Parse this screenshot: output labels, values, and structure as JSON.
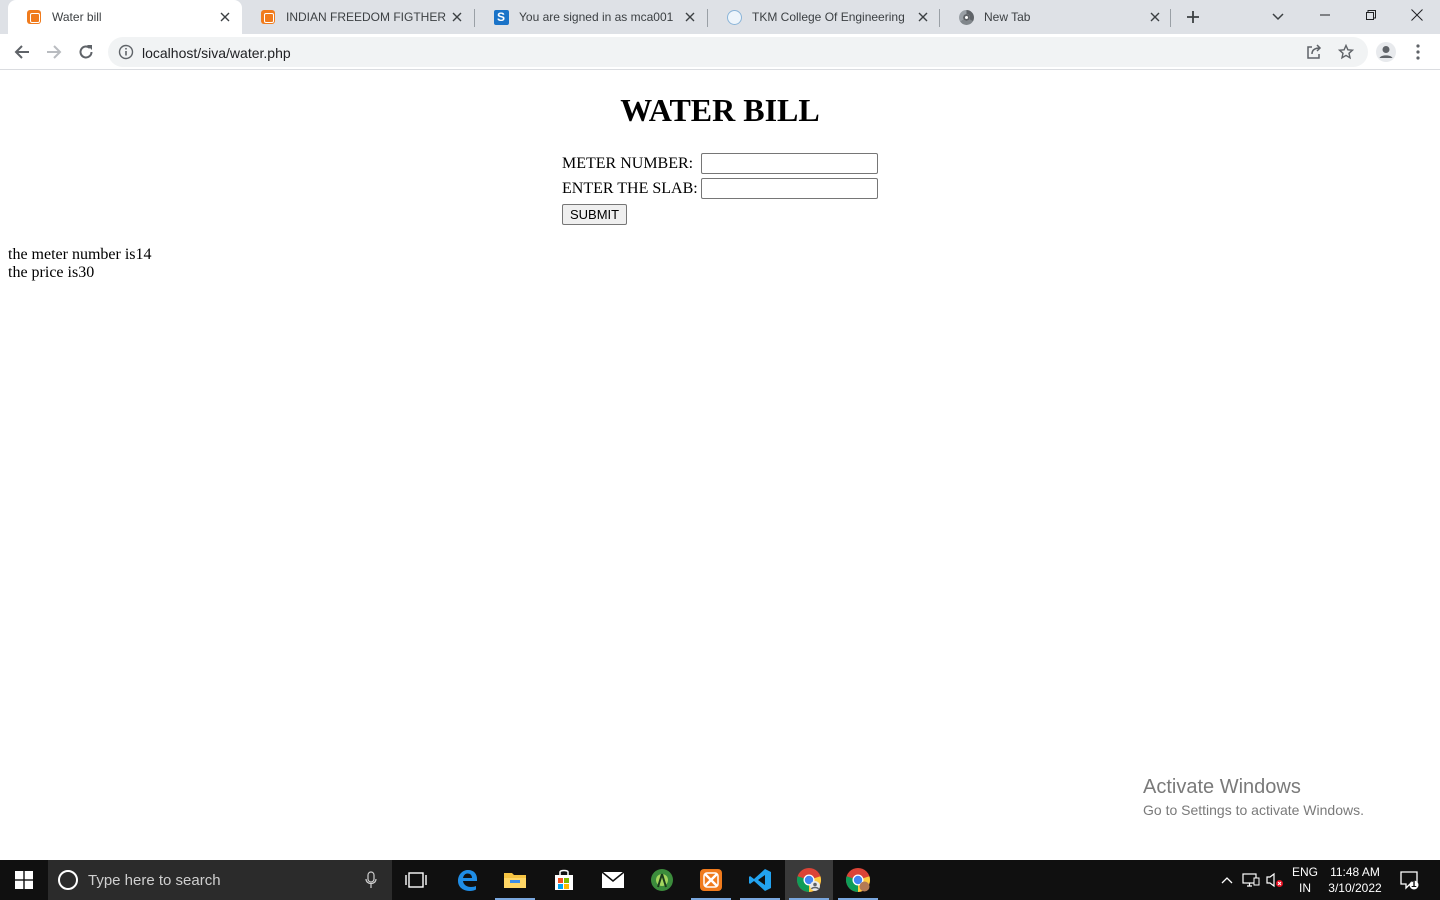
{
  "browser": {
    "tabs": [
      {
        "title": "Water bill",
        "favicon": "xampp-icon",
        "active": true
      },
      {
        "title": "INDIAN FREEDOM FIGTHER",
        "favicon": "xampp-icon",
        "active": false
      },
      {
        "title": "You are signed in as mca001",
        "favicon": "s-site-icon",
        "active": false
      },
      {
        "title": "TKM College Of Engineering",
        "favicon": "college-logo-icon",
        "active": false
      },
      {
        "title": "New Tab",
        "favicon": "chrome-icon",
        "active": false
      }
    ],
    "url": "localhost/siva/water.php"
  },
  "page": {
    "heading": "WATER BILL",
    "form": {
      "meter_label": "METER NUMBER:",
      "meter_value": "",
      "slab_label": "ENTER THE SLAB:",
      "slab_value": "",
      "submit_label": "SUBMIT"
    },
    "result": {
      "meter_line": "the meter number is14",
      "price_line": "the price is30"
    },
    "watermark": {
      "title": "Activate Windows",
      "subtitle": "Go to Settings to activate Windows."
    }
  },
  "taskbar": {
    "search_placeholder": "Type here to search",
    "apps": [
      "task-view",
      "edge",
      "file-explorer",
      "microsoft-store",
      "mail",
      "android-studio",
      "xampp",
      "vscode",
      "chrome",
      "chrome-profile"
    ],
    "language": "ENG",
    "region": "IN",
    "time": "11:48 AM",
    "date": "3/10/2022",
    "notification_count": "1"
  },
  "colors": {
    "tabstrip_bg": "#dee1e6",
    "taskbar_bg": "#101010",
    "xampp_orange": "#f07b1d",
    "vscode_blue": "#22a3f0"
  }
}
